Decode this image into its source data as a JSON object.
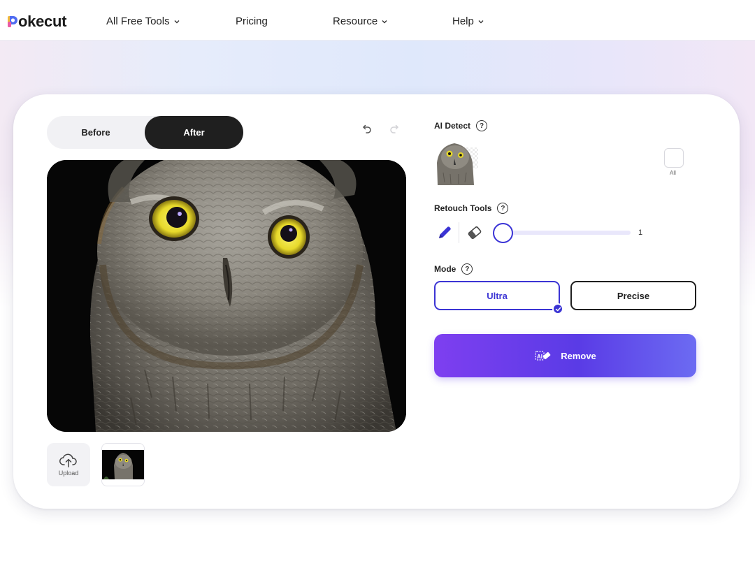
{
  "nav": {
    "logo_text": "okecut",
    "items": [
      {
        "label": "All Free Tools",
        "has_dropdown": true
      },
      {
        "label": "Pricing",
        "has_dropdown": false
      },
      {
        "label": "Resource",
        "has_dropdown": true
      },
      {
        "label": "Help",
        "has_dropdown": true
      }
    ]
  },
  "editor": {
    "toggle": {
      "before_label": "Before",
      "after_label": "After",
      "selected": "After"
    },
    "undo_icon": "undo-icon",
    "redo_icon": "redo-icon",
    "upload_label": "Upload"
  },
  "panel": {
    "ai_detect_label": "AI Detect",
    "all_label": "All",
    "retouch_label": "Retouch Tools",
    "brush_size": "1",
    "mode_label": "Mode",
    "modes": [
      {
        "label": "Ultra",
        "selected": true
      },
      {
        "label": "Precise",
        "selected": false
      }
    ],
    "remove_label": "Remove"
  },
  "colors": {
    "accent": "#3b34d4",
    "remove_gradient_start": "#7e3ff0",
    "remove_gradient_end": "#6c6bf2"
  }
}
